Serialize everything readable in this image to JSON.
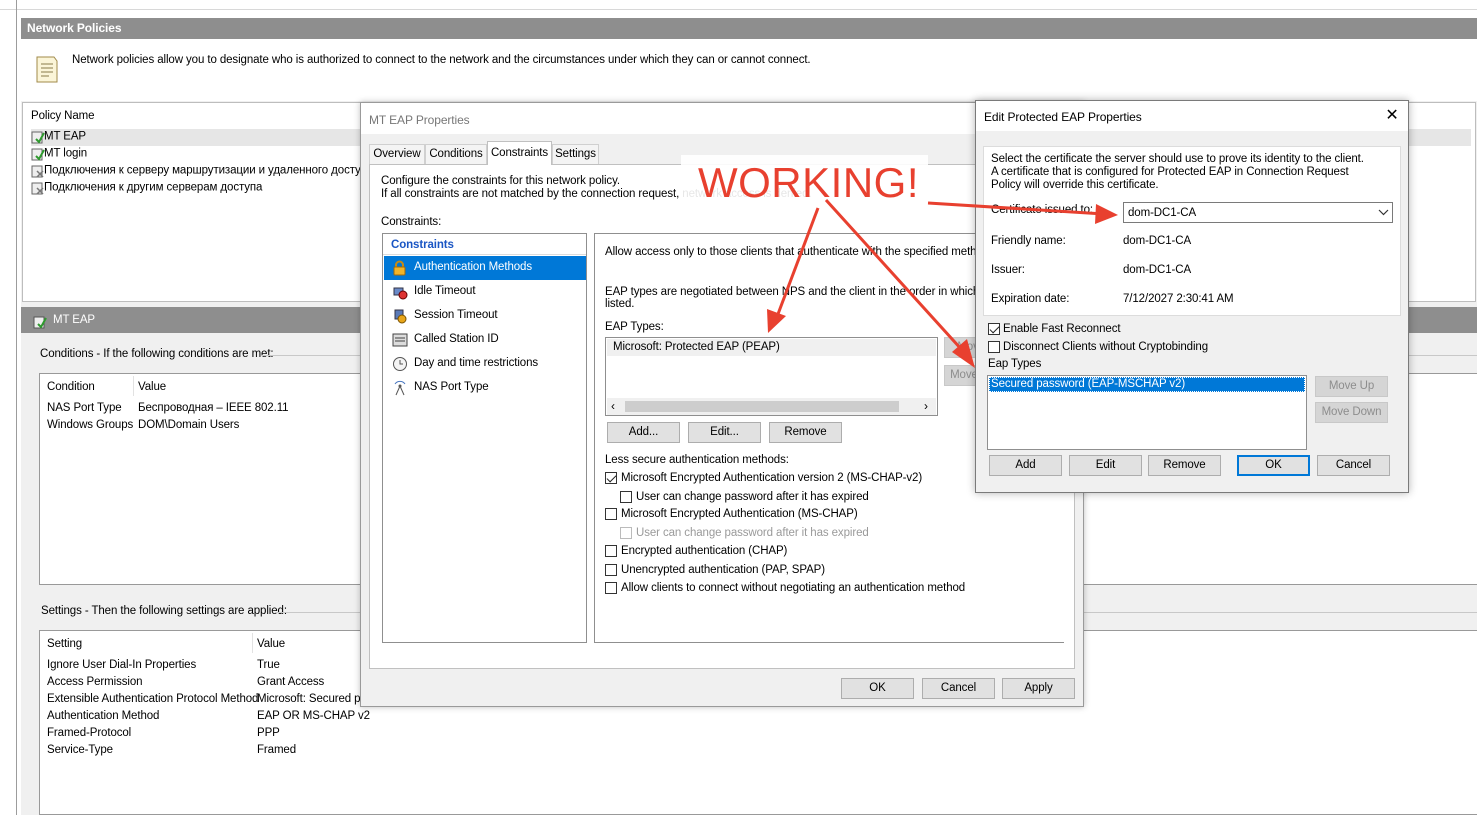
{
  "main": {
    "title": "Network Policies",
    "description": "Network policies allow you to designate who is authorized to connect to the network and the circumstances under which they can or cannot connect.",
    "policy_header": "Policy Name",
    "policies": [
      "MT EAP",
      "MT login",
      "Подключения к серверу маршрутизации и удаленного доступа",
      "Подключения к другим серверам доступа"
    ],
    "selected_title": "MT EAP",
    "conditions_label": "Conditions - If the following conditions are met:",
    "conditions_cols": [
      "Condition",
      "Value"
    ],
    "conditions": [
      {
        "name": "NAS Port Type",
        "value": "Беспроводная – IEEE 802.11"
      },
      {
        "name": "Windows Groups",
        "value": "DOM\\Domain Users"
      }
    ],
    "settings_label": "Settings - Then the following settings are applied:",
    "settings_cols": [
      "Setting",
      "Value"
    ],
    "settings": [
      {
        "name": "Ignore User Dial-In Properties",
        "value": "True"
      },
      {
        "name": "Access Permission",
        "value": "Grant Access"
      },
      {
        "name": "Extensible Authentication Protocol Method",
        "value": "Microsoft: Secured pa"
      },
      {
        "name": "Authentication Method",
        "value": "EAP OR MS-CHAP v2"
      },
      {
        "name": "Framed-Protocol",
        "value": "PPP"
      },
      {
        "name": "Service-Type",
        "value": "Framed"
      }
    ]
  },
  "props": {
    "title": "MT EAP Properties",
    "tabs": [
      "Overview",
      "Conditions",
      "Constraints",
      "Settings"
    ],
    "intro1": "Configure the constraints for this network policy.",
    "intro2": "If all constraints are not matched by the connection request, network access is denied.",
    "constraints_label": "Constraints:",
    "tree_header": "Constraints",
    "tree": [
      "Authentication Methods",
      "Idle Timeout",
      "Session Timeout",
      "Called Station ID",
      "Day and time restrictions",
      "NAS Port Type"
    ],
    "allow_text": "Allow access only to those clients that authenticate with the specified methods.",
    "eap_desc1": "EAP types are negotiated between NPS and the client in the order in which they are",
    "eap_desc2": "listed.",
    "eap_types_label": "EAP Types:",
    "eap_item": "Microsoft: Protected EAP (PEAP)",
    "move_up": "Move Up",
    "move_down": "Move Down",
    "add": "Add...",
    "edit": "Edit...",
    "remove": "Remove",
    "less_secure": "Less secure authentication methods:",
    "checks": [
      "Microsoft Encrypted Authentication version 2 (MS-CHAP-v2)",
      "User can change password after it has expired",
      "Microsoft Encrypted Authentication (MS-CHAP)",
      "User can change password after it has expired",
      "Encrypted authentication (CHAP)",
      "Unencrypted authentication (PAP, SPAP)",
      "Allow clients to connect without negotiating an authentication method"
    ],
    "ok": "OK",
    "cancel": "Cancel",
    "apply": "Apply"
  },
  "peap": {
    "title": "Edit Protected EAP Properties",
    "desc1": "Select the certificate the server should use to prove its identity to the client.",
    "desc2": "A certificate that is configured for Protected EAP in Connection Request",
    "desc3": "Policy will override this certificate.",
    "cert_label": "Certificate issued to:",
    "cert_value": "dom-DC1-CA",
    "friendly_label": "Friendly name:",
    "friendly_value": "dom-DC1-CA",
    "issuer_label": "Issuer:",
    "issuer_value": "dom-DC1-CA",
    "exp_label": "Expiration date:",
    "exp_value": "7/12/2027 2:30:41 AM",
    "fast_reconnect": "Enable Fast Reconnect",
    "disconnect": "Disconnect Clients without Cryptobinding",
    "eap_types_label": "Eap Types",
    "eap_item": "Secured password (EAP-MSCHAP v2)",
    "move_up": "Move Up",
    "move_down": "Move Down",
    "add": "Add",
    "edit": "Edit",
    "remove": "Remove",
    "ok": "OK",
    "cancel": "Cancel"
  },
  "annotation": {
    "text": "WORKING!",
    "color": "#e8402f"
  }
}
